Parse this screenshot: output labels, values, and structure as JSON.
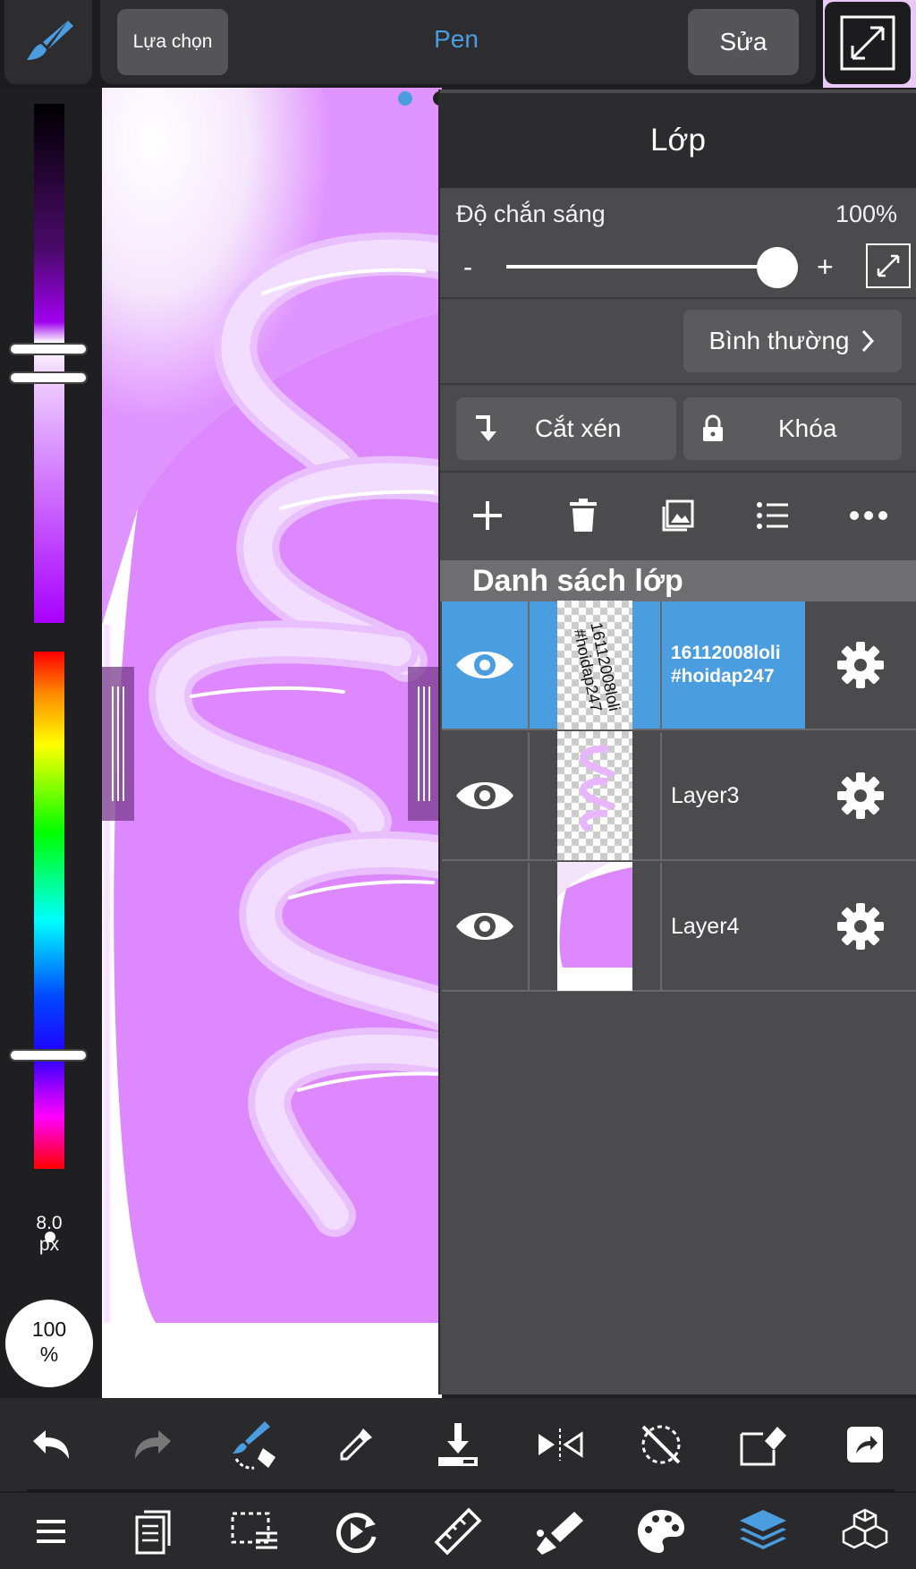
{
  "header": {
    "select_label": "Lựa chọn",
    "tool_name": "Pen",
    "edit_label": "Sửa"
  },
  "palette": {
    "brush_size_value": "8.0",
    "brush_size_unit": "px",
    "zoom_value": "100",
    "zoom_unit": "%"
  },
  "layer_panel": {
    "title": "Lớp",
    "opacity_label": "Độ chắn sáng",
    "opacity_value": "100%",
    "opacity_level": 1.0,
    "minus_label": "-",
    "plus_label": "+",
    "blend_mode": "Bình thường",
    "clip_label": "Cắt xén",
    "lock_label": "Khóa",
    "list_header": "Danh sách lớp",
    "layers": [
      {
        "name_line1": "16112008loli",
        "name_line2": "#hoidap247",
        "thumb_text_1": "16112008loli",
        "thumb_text_2": "#hoidap247",
        "visible": true,
        "selected": true
      },
      {
        "name": "Layer3",
        "visible": true,
        "selected": false
      },
      {
        "name": "Layer4",
        "visible": true,
        "selected": false
      }
    ]
  },
  "colors": {
    "accent": "#4a9ee0",
    "panel": "#4b4b4d",
    "canvas_purple": "#dd88ff",
    "brush_stroke": "#f0d8ff"
  }
}
